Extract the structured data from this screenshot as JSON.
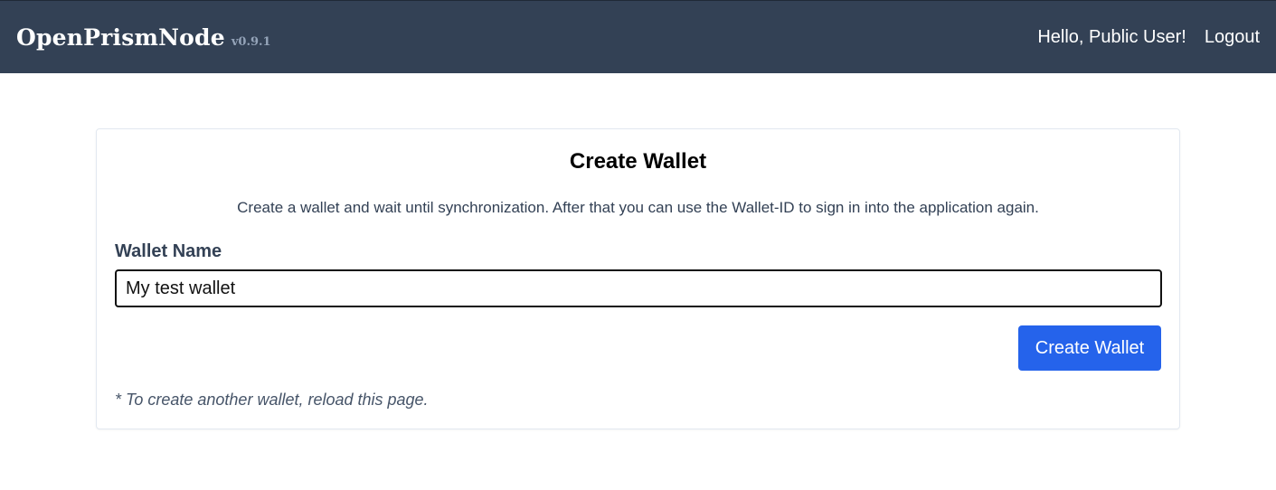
{
  "header": {
    "brand": "OpenPrismNode",
    "version": "v0.9.1",
    "greeting": "Hello, Public User!",
    "logout_label": "Logout"
  },
  "card": {
    "title": "Create Wallet",
    "description": "Create a wallet and wait until synchronization. After that you can use the Wallet-ID to sign in into the application again.",
    "field_label": "Wallet Name",
    "field_value": "My test wallet",
    "submit_label": "Create Wallet",
    "note": "* To create another wallet, reload this page."
  },
  "colors": {
    "navbar": "#334155",
    "primary_button": "#2563eb",
    "text_muted": "#475569"
  }
}
